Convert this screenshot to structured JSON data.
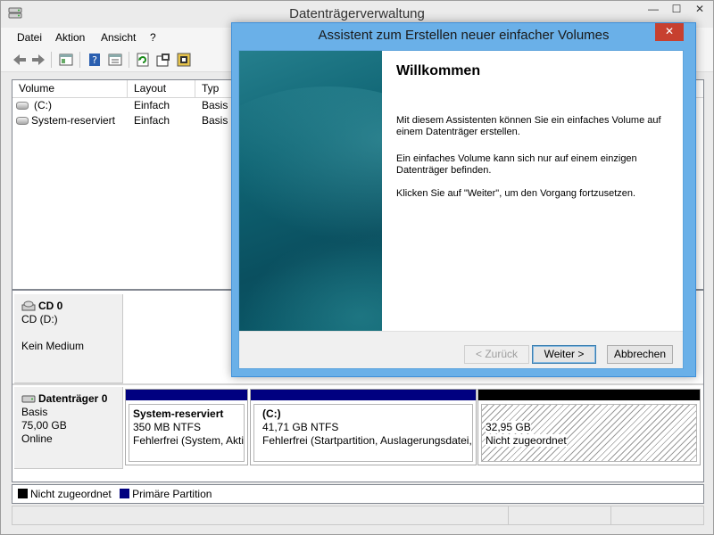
{
  "window": {
    "title": "Datenträgerverwaltung",
    "minimize": "—",
    "maximize": "☐",
    "close": "✕"
  },
  "menu": [
    "Datei",
    "Aktion",
    "Ansicht",
    "?"
  ],
  "volume_list": {
    "columns": [
      "Volume",
      "Layout",
      "Typ"
    ],
    "rows": [
      {
        "volume": "(C:)",
        "layout": "Einfach",
        "typ": "Basis"
      },
      {
        "volume": "System-reserviert",
        "layout": "Einfach",
        "typ": "Basis"
      }
    ]
  },
  "disks": [
    {
      "name": "CD 0",
      "lines": [
        "CD (D:)",
        "",
        "Kein Medium"
      ]
    },
    {
      "name": "Datenträger 0",
      "lines": [
        "Basis",
        "75,00 GB",
        "Online"
      ],
      "partitions": [
        {
          "name": "System-reserviert",
          "size": "350 MB NTFS",
          "status": "Fehlerfrei (System, Aktiv"
        },
        {
          "name": "(C:)",
          "size": "41,71 GB NTFS",
          "status": "Fehlerfrei (Startpartition, Auslagerungsdatei, A"
        },
        {
          "name": "",
          "size": "32,95 GB",
          "status": "Nicht zugeordnet"
        }
      ]
    }
  ],
  "legend": [
    {
      "label": "Nicht zugeordnet",
      "color": "#000000"
    },
    {
      "label": "Primäre Partition",
      "color": "#000080"
    }
  ],
  "wizard": {
    "title": "Assistent zum Erstellen neuer einfacher Volumes",
    "close": "✕",
    "heading": "Willkommen",
    "paragraphs": [
      "Mit diesem Assistenten können Sie ein einfaches Volume auf einem Datenträger erstellen.",
      "Ein einfaches Volume kann sich nur auf einem einzigen Datenträger befinden.",
      "Klicken Sie auf \"Weiter\", um den Vorgang fortzusetzen."
    ],
    "buttons": {
      "back": "< Zurück",
      "next": "Weiter >",
      "cancel": "Abbrechen"
    }
  },
  "colors": {
    "primary_partition": "#000080",
    "unallocated": "#000000",
    "wizard_border": "#6ab0e8",
    "close_button": "#c7402f"
  }
}
